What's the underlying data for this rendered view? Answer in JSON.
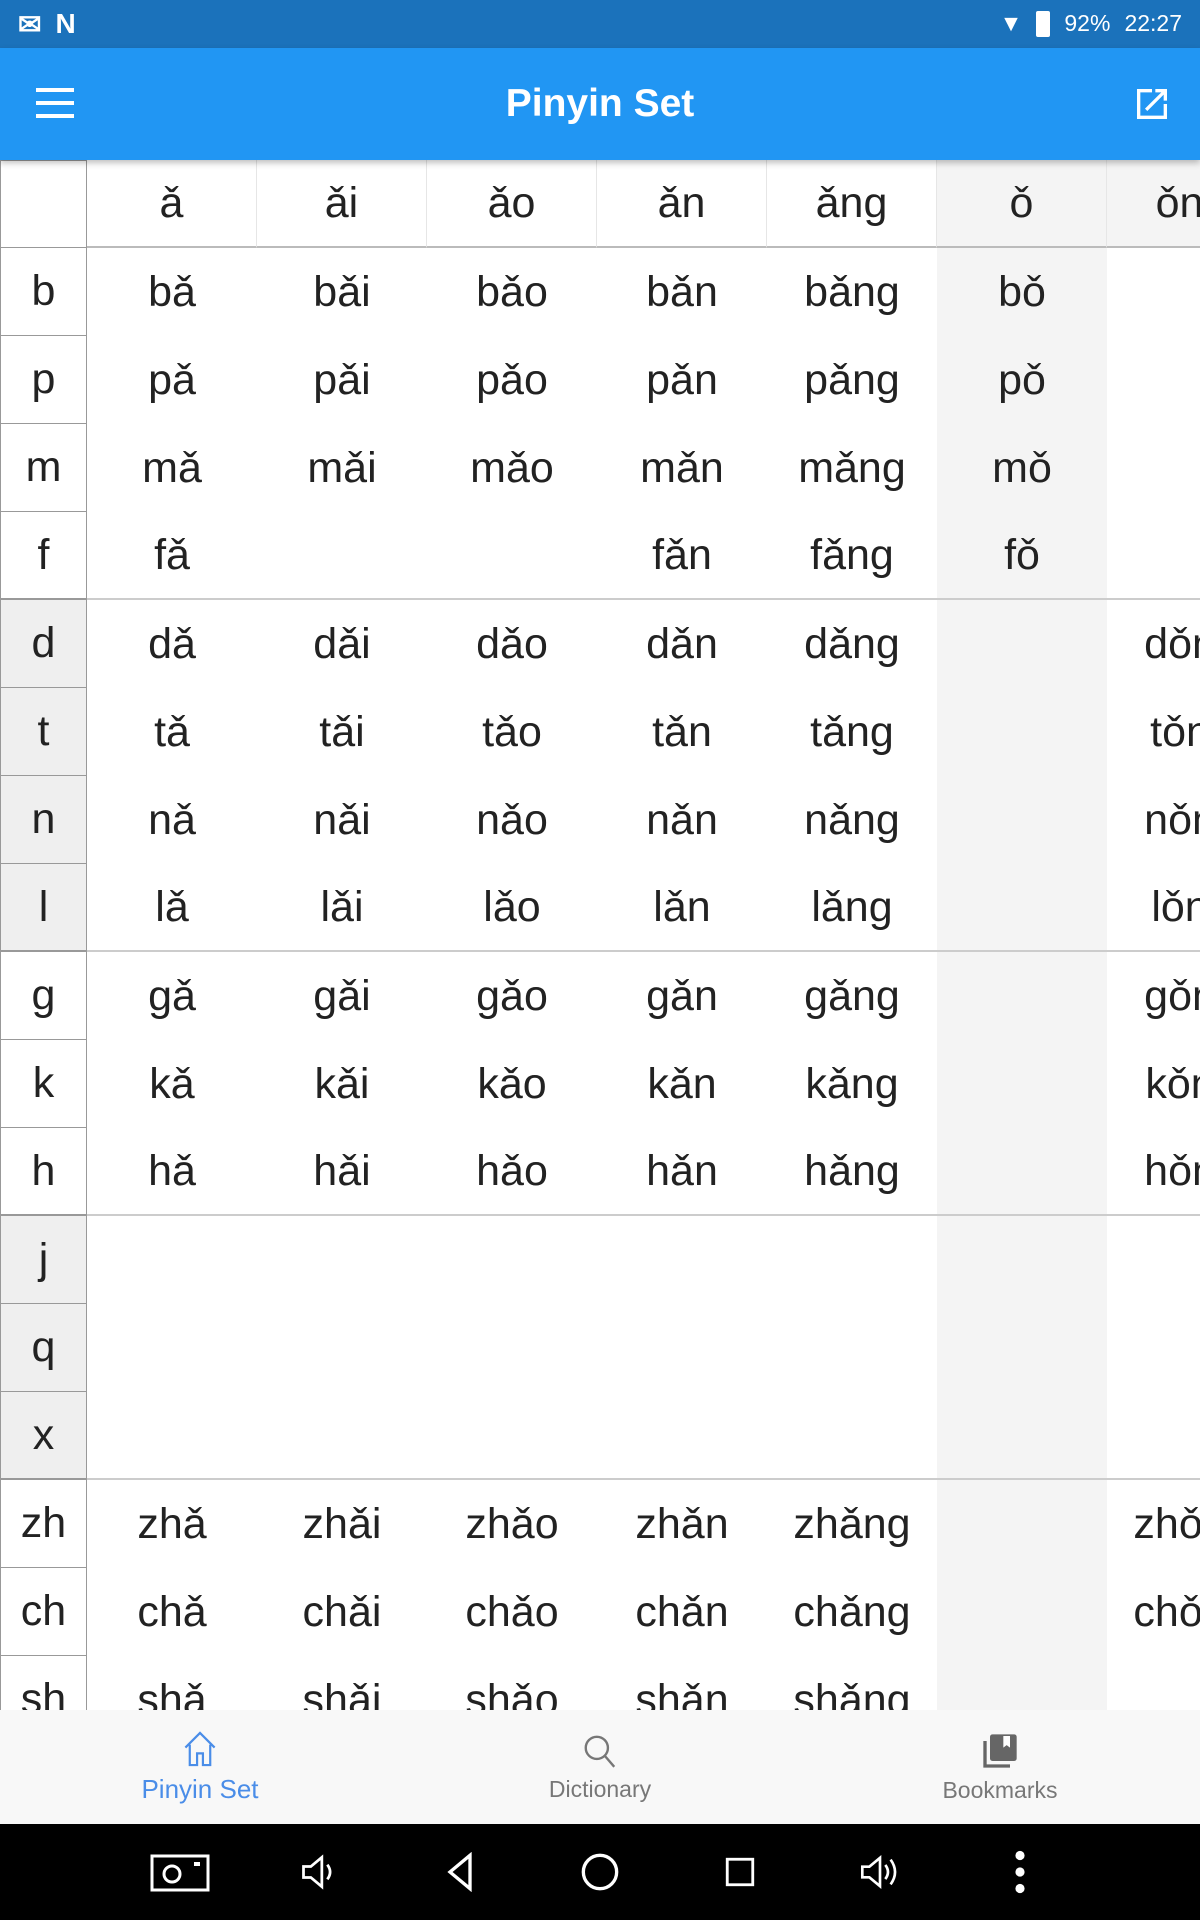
{
  "status": {
    "battery": "92%",
    "time": "22:27"
  },
  "appbar": {
    "title": "Pinyin Set"
  },
  "table": {
    "columns": [
      "ǎ",
      "ǎi",
      "ǎo",
      "ǎn",
      "ǎng",
      "ǒ",
      "ǒng"
    ],
    "rows": [
      {
        "initial": "b",
        "cells": [
          "bǎ",
          "bǎi",
          "bǎo",
          "bǎn",
          "bǎng",
          "bǒ",
          ""
        ]
      },
      {
        "initial": "p",
        "cells": [
          "pǎ",
          "pǎi",
          "pǎo",
          "pǎn",
          "pǎng",
          "pǒ",
          ""
        ]
      },
      {
        "initial": "m",
        "cells": [
          "mǎ",
          "mǎi",
          "mǎo",
          "mǎn",
          "mǎng",
          "mǒ",
          ""
        ]
      },
      {
        "initial": "f",
        "cells": [
          "fǎ",
          "",
          "",
          "fǎn",
          "fǎng",
          "fǒ",
          ""
        ]
      },
      {
        "initial": "d",
        "cells": [
          "dǎ",
          "dǎi",
          "dǎo",
          "dǎn",
          "dǎng",
          "",
          "dǒng"
        ]
      },
      {
        "initial": "t",
        "cells": [
          "tǎ",
          "tǎi",
          "tǎo",
          "tǎn",
          "tǎng",
          "",
          "tǒng"
        ]
      },
      {
        "initial": "n",
        "cells": [
          "nǎ",
          "nǎi",
          "nǎo",
          "nǎn",
          "nǎng",
          "",
          "nǒng"
        ]
      },
      {
        "initial": "l",
        "cells": [
          "lǎ",
          "lǎi",
          "lǎo",
          "lǎn",
          "lǎng",
          "",
          "lǒng"
        ]
      },
      {
        "initial": "g",
        "cells": [
          "gǎ",
          "gǎi",
          "gǎo",
          "gǎn",
          "gǎng",
          "",
          "gǒng"
        ]
      },
      {
        "initial": "k",
        "cells": [
          "kǎ",
          "kǎi",
          "kǎo",
          "kǎn",
          "kǎng",
          "",
          "kǒng"
        ]
      },
      {
        "initial": "h",
        "cells": [
          "hǎ",
          "hǎi",
          "hǎo",
          "hǎn",
          "hǎng",
          "",
          "hǒng"
        ]
      },
      {
        "initial": "j",
        "cells": [
          "",
          "",
          "",
          "",
          "",
          "",
          ""
        ]
      },
      {
        "initial": "q",
        "cells": [
          "",
          "",
          "",
          "",
          "",
          "",
          ""
        ]
      },
      {
        "initial": "x",
        "cells": [
          "",
          "",
          "",
          "",
          "",
          "",
          ""
        ]
      },
      {
        "initial": "zh",
        "cells": [
          "zhǎ",
          "zhǎi",
          "zhǎo",
          "zhǎn",
          "zhǎng",
          "",
          "zhǒng"
        ]
      },
      {
        "initial": "ch",
        "cells": [
          "chǎ",
          "chǎi",
          "chǎo",
          "chǎn",
          "chǎng",
          "",
          "chǒng"
        ]
      },
      {
        "initial": "sh",
        "cells": [
          "shǎ",
          "shǎi",
          "shǎo",
          "shǎn",
          "shǎng",
          "",
          ""
        ]
      }
    ],
    "shaded_groups": [
      1,
      3
    ]
  },
  "bottom_nav": [
    {
      "label": "Pinyin Set",
      "icon": "home-icon",
      "active": true
    },
    {
      "label": "Dictionary",
      "icon": "search-icon"
    },
    {
      "label": "Bookmarks",
      "icon": "bookmarks-icon"
    }
  ],
  "colors": {
    "statusbar": "#1b72bb",
    "appbar": "#2196f3",
    "active_tab": "#4a8de8",
    "shade": "#f2f2f2"
  }
}
